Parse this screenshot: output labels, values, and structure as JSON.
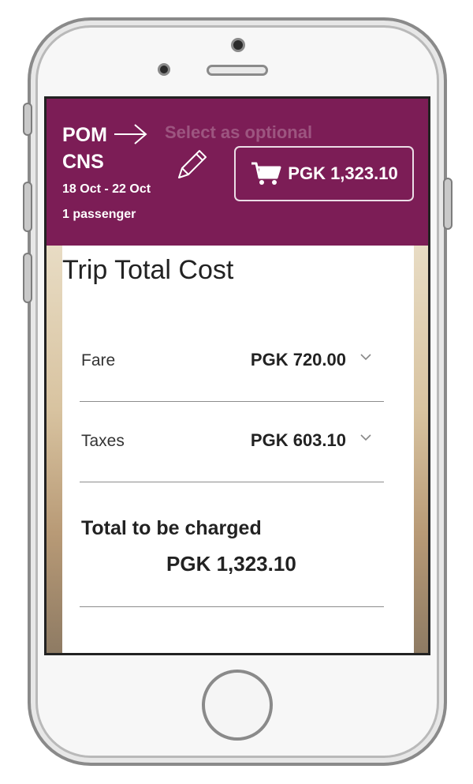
{
  "header": {
    "background_text": "Select as optional",
    "origin": "POM",
    "destination": "CNS",
    "dates": "18 Oct - 22 Oct",
    "passengers": "1 passenger",
    "cart_total": "PGK 1,323.10"
  },
  "summary": {
    "title": "Trip Total Cost",
    "rows": [
      {
        "label": "Fare",
        "amount": "PGK 720.00"
      },
      {
        "label": "Taxes",
        "amount": "PGK 603.10"
      }
    ],
    "total_label": "Total to be charged",
    "total_amount": "PGK 1,323.10"
  },
  "colors": {
    "header_bg": "#7c1d56",
    "text": "#222222"
  },
  "icons": [
    "arrow-right-icon",
    "pencil-icon",
    "cart-icon",
    "chevron-down-icon"
  ]
}
